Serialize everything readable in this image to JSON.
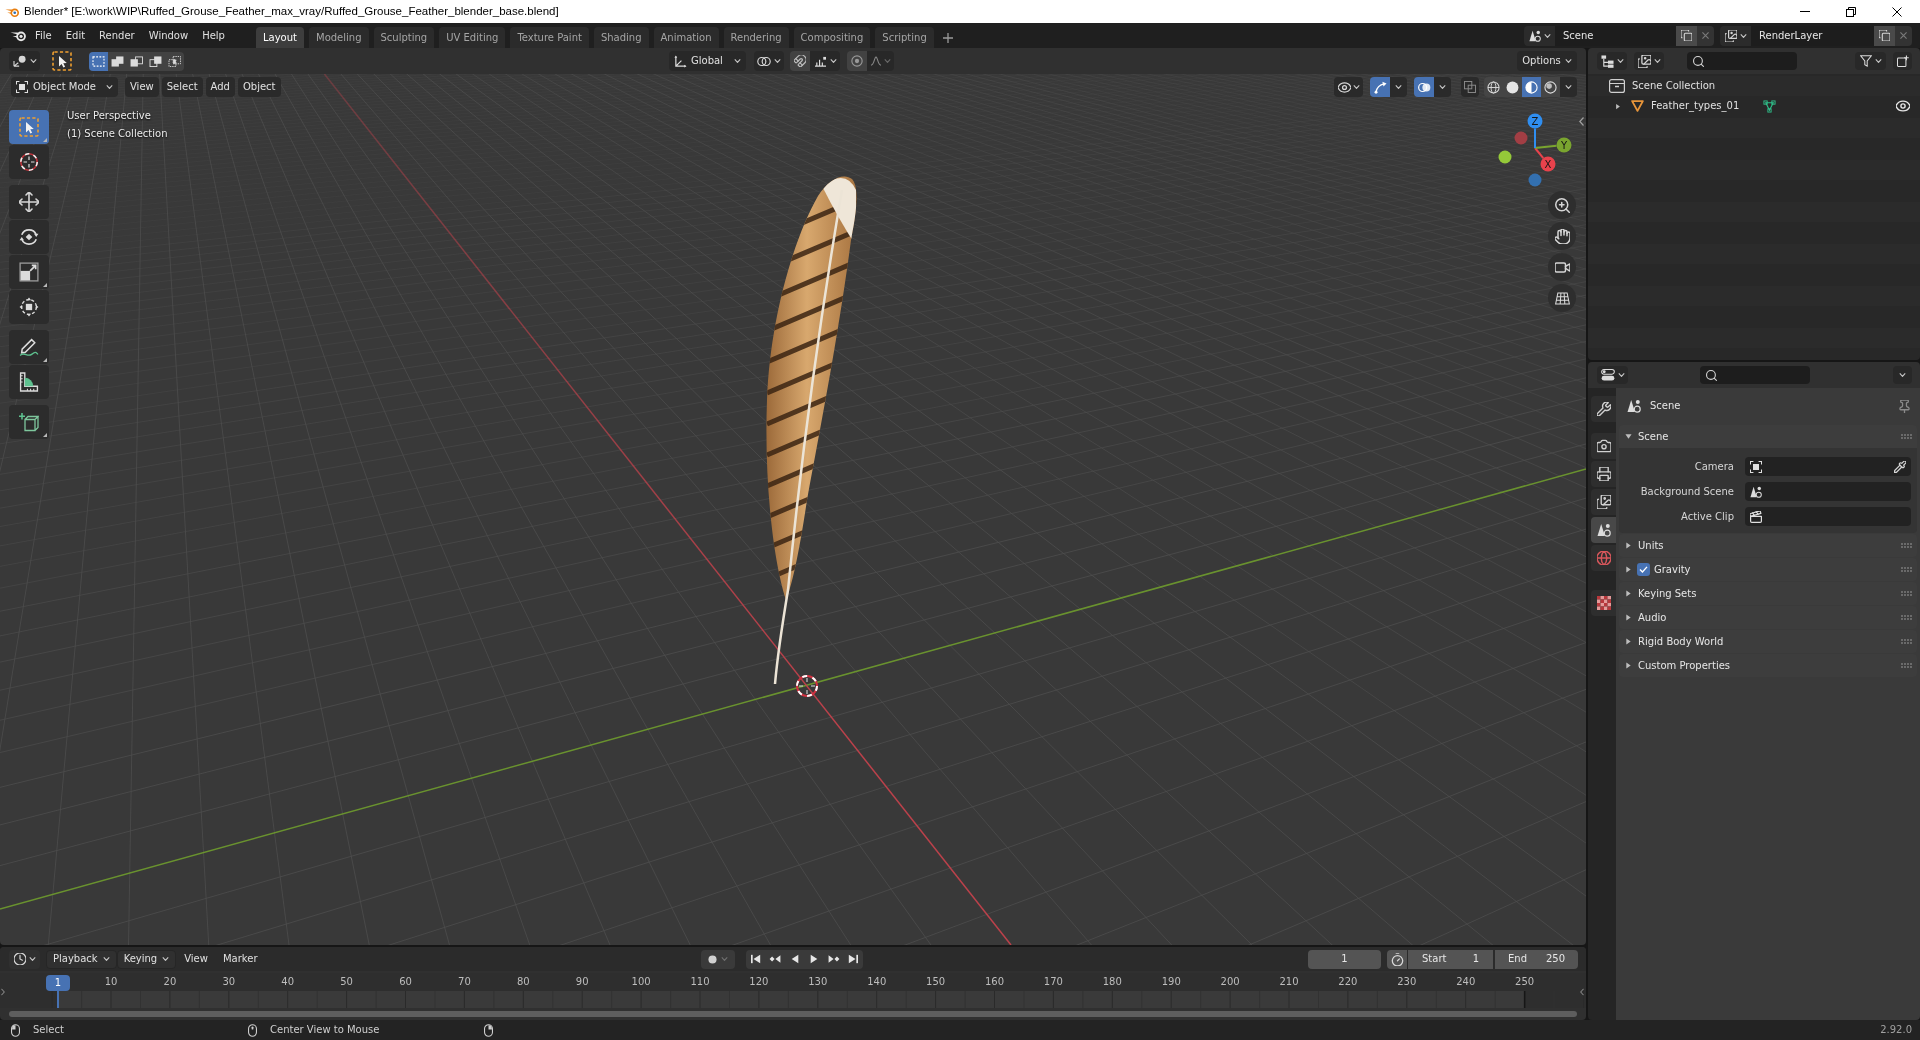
{
  "window": {
    "title": "Blender* [E:\\work\\WIP\\Ruffed_Grouse_Feather_max_vray/Ruffed_Grouse_Feather_blender_base.blend]"
  },
  "menu": [
    "File",
    "Edit",
    "Render",
    "Window",
    "Help"
  ],
  "workspaces": [
    {
      "label": "Layout",
      "selected": true
    },
    {
      "label": "Modeling",
      "selected": false
    },
    {
      "label": "Sculpting",
      "selected": false
    },
    {
      "label": "UV Editing",
      "selected": false
    },
    {
      "label": "Texture Paint",
      "selected": false
    },
    {
      "label": "Shading",
      "selected": false
    },
    {
      "label": "Animation",
      "selected": false
    },
    {
      "label": "Rendering",
      "selected": false
    },
    {
      "label": "Compositing",
      "selected": false
    },
    {
      "label": "Scripting",
      "selected": false
    }
  ],
  "scene_selector": {
    "value": "Scene"
  },
  "view_layer_selector": {
    "value": "RenderLayer"
  },
  "viewport": {
    "tool_header": {
      "select_modes": [
        {
          "kind": "set",
          "selected": true
        },
        {
          "kind": "extend",
          "selected": false
        },
        {
          "kind": "subtract",
          "selected": false
        },
        {
          "kind": "difference",
          "selected": false
        },
        {
          "kind": "intersect",
          "selected": false
        }
      ],
      "orientation": "Global",
      "options": "Options"
    },
    "header": {
      "mode": "Object Mode",
      "menus": [
        "View",
        "Select",
        "Add",
        "Object"
      ],
      "toggles": [
        {
          "kind": "gizmos",
          "on": true
        },
        {
          "kind": "overlays",
          "on": true
        },
        {
          "kind": "xray",
          "on": false
        }
      ],
      "shading": [
        {
          "kind": "wireframe",
          "selected": false
        },
        {
          "kind": "solid",
          "selected": false
        },
        {
          "kind": "material",
          "selected": true
        },
        {
          "kind": "rendered",
          "selected": false
        }
      ]
    },
    "info": [
      "User Perspective",
      "(1) Scene Collection"
    ],
    "tool_groups": [
      [
        {
          "kind": "select_box",
          "selected": true,
          "submenu": true
        },
        {
          "kind": "cursor",
          "selected": false,
          "submenu": false
        }
      ],
      [
        {
          "kind": "move",
          "selected": false,
          "submenu": false
        },
        {
          "kind": "rotate",
          "selected": false,
          "submenu": false
        },
        {
          "kind": "scale",
          "selected": false,
          "submenu": true
        },
        {
          "kind": "transform",
          "selected": false,
          "submenu": false
        }
      ],
      [
        {
          "kind": "annotate",
          "selected": false,
          "submenu": true
        },
        {
          "kind": "measure",
          "selected": false,
          "submenu": false
        }
      ],
      [
        {
          "kind": "add_cube",
          "selected": false,
          "submenu": true
        }
      ]
    ],
    "axes": [
      {
        "label": "X",
        "color": "#e8424c"
      },
      {
        "label": "Y",
        "color": "#7aa52f"
      },
      {
        "label": "Z",
        "color": "#2f8ef0"
      }
    ]
  },
  "outliner": {
    "root": "Scene Collection",
    "items": [
      {
        "label": "Feather_types_01",
        "expanded": false,
        "visible": true
      }
    ]
  },
  "properties": {
    "tab_groups": [
      [
        {
          "kind": "tool",
          "selected": false
        }
      ],
      [
        {
          "kind": "render",
          "selected": false
        },
        {
          "kind": "output",
          "selected": false
        },
        {
          "kind": "view_layer",
          "selected": false
        },
        {
          "kind": "scene",
          "selected": true
        },
        {
          "kind": "world",
          "selected": false
        }
      ],
      [
        {
          "kind": "texture",
          "selected": false
        }
      ]
    ],
    "context": "Scene",
    "panels": [
      {
        "title": "Scene",
        "expanded": true,
        "fields": [
          {
            "label": "Camera",
            "kind": "camera"
          },
          {
            "label": "Background Scene",
            "kind": "scene"
          },
          {
            "label": "Active Clip",
            "kind": "clip"
          }
        ]
      },
      {
        "title": "Units",
        "expanded": false
      },
      {
        "title": "Gravity",
        "expanded": false,
        "checked": true
      },
      {
        "title": "Keying Sets",
        "expanded": false
      },
      {
        "title": "Audio",
        "expanded": false
      },
      {
        "title": "Rigid Body World",
        "expanded": false
      },
      {
        "title": "Custom Properties",
        "expanded": false
      }
    ]
  },
  "timeline": {
    "menus": [
      {
        "label": "Playback",
        "kind": "dropdown"
      },
      {
        "label": "Keying",
        "kind": "dropdown"
      },
      {
        "label": "View",
        "kind": "menu"
      },
      {
        "label": "Marker",
        "kind": "menu"
      }
    ],
    "auto_keying": false,
    "current_frame": "1",
    "start": {
      "label": "Start",
      "value": "1"
    },
    "end": {
      "label": "End",
      "value": "250"
    },
    "playhead": "1",
    "ruler": [
      "10",
      "20",
      "30",
      "40",
      "50",
      "60",
      "70",
      "80",
      "90",
      "100",
      "110",
      "120",
      "130",
      "140",
      "150",
      "160",
      "170",
      "180",
      "190",
      "200",
      "210",
      "220",
      "230",
      "240",
      "250"
    ]
  },
  "status_bar": {
    "hints": [
      {
        "kind": "left",
        "label": "Select"
      },
      {
        "kind": "middle",
        "label": "Center View to Mouse"
      },
      {
        "kind": "right"
      }
    ],
    "version": "2.92.0"
  }
}
